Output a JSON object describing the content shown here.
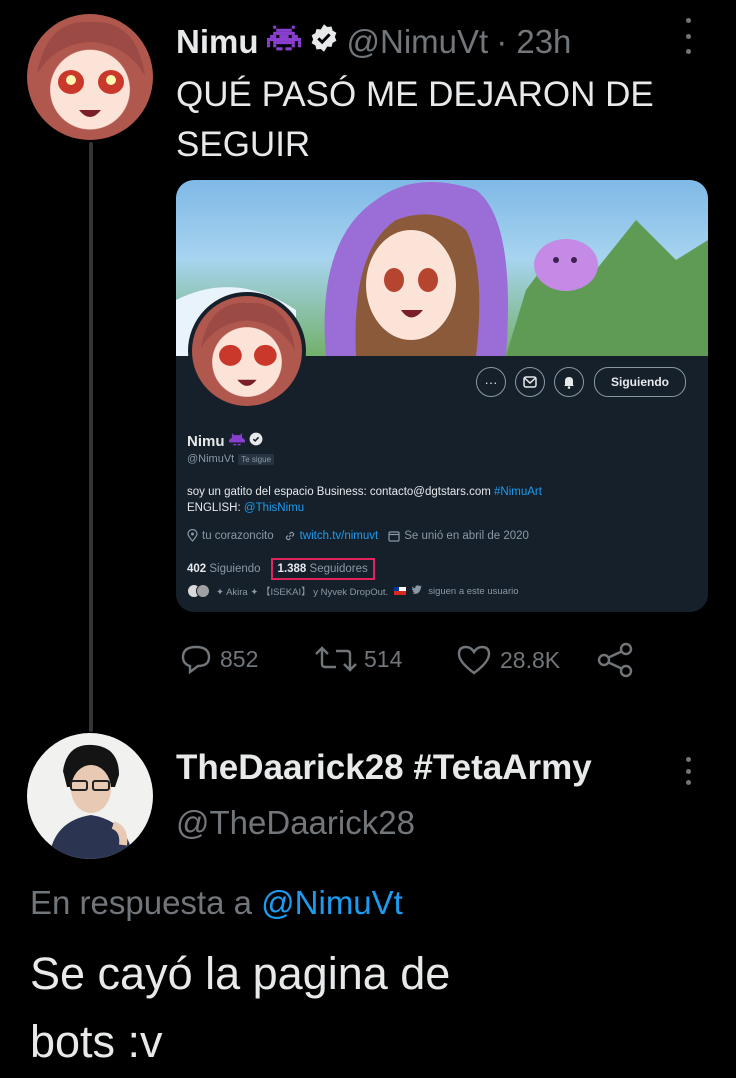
{
  "tweet": {
    "author_name": "Nimu",
    "author_handle": "@NimuVt",
    "time": "· 23h",
    "text_line1": "QUÉ PASÓ ME DEJARON DE",
    "text_line2": "SEGUIR",
    "replies": "852",
    "retweets": "514",
    "likes": "28.8K"
  },
  "embedded_profile": {
    "name": "Nimu",
    "handle": "@NimuVt",
    "follows_you": "Te sigue",
    "follow_button": "Siguiendo",
    "bio_text": "soy un gatito del espacio Business: contacto@dgtstars.com",
    "bio_hashtag": "#NimuArt",
    "bio_line2_label": "ENGLISH:",
    "bio_line2_link": "@ThisNimu",
    "location": "tu corazoncito",
    "website": "twitch.tv/nimuvt",
    "joined": "Se unió en abril de 2020",
    "following_count": "402",
    "following_label": "Siguiendo",
    "followers_count": "1.388",
    "followers_label": "Seguidores",
    "followed_by_text": "✦ Akira ✦ 【ISEKAI】 y Nyvek DropOut.",
    "followed_by_suffix": "siguen a este usuario"
  },
  "reply": {
    "author_name": "TheDaarick28 #TetaArmy",
    "author_handle": "@TheDaarick28",
    "replying_prefix": "En respuesta a",
    "replying_to": "@NimuVt",
    "text_line1": "Se cayó la pagina de",
    "text_line2": "bots :v"
  },
  "colors": {
    "background": "#000000",
    "accent": "#1d9bf0",
    "muted": "#71767b",
    "highlight_box": "#e0245e",
    "verified": "#e7e9ea",
    "emoji_purple": "#8b3fd1"
  },
  "icons": [
    "alien-monster-emoji-icon",
    "verified-badge-icon",
    "more-icon",
    "reply-icon",
    "retweet-icon",
    "like-icon",
    "share-icon",
    "ellipsis-icon",
    "message-icon",
    "notification-bell-icon",
    "location-icon",
    "link-icon",
    "calendar-icon",
    "chile-flag-icon",
    "twitter-bird-icon"
  ]
}
